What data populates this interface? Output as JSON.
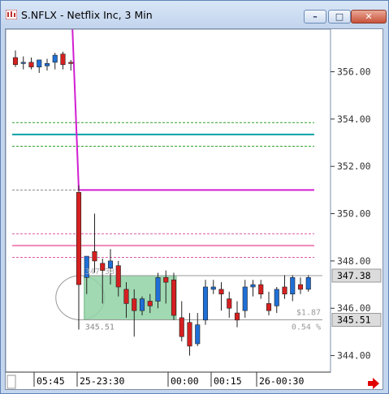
{
  "window": {
    "title": "S.NFLX - Netflix Inc, 3 Min",
    "buttons": {
      "minimize": "–",
      "maximize": "□",
      "close": "✕"
    }
  },
  "chart_data": {
    "type": "candlestick",
    "title": "S.NFLX - Netflix Inc, 3 Min",
    "ylim": [
      343.3,
      357.8
    ],
    "y_ticks": [
      {
        "value": 356,
        "label": "356.00"
      },
      {
        "value": 354,
        "label": "354.00"
      },
      {
        "value": 352,
        "label": "352.00"
      },
      {
        "value": 350,
        "label": "350.00"
      },
      {
        "value": 348,
        "label": "348.00"
      },
      {
        "value": 346,
        "label": "346.00"
      },
      {
        "value": 344,
        "label": "344.00"
      }
    ],
    "x_ticks": [
      "05:45",
      "25-23:30",
      "00:00",
      "00:15",
      "26-00:30"
    ],
    "price_tags": [
      {
        "value": 347.38,
        "label": "347.38"
      },
      {
        "value": 345.51,
        "label": "345.51"
      }
    ],
    "box_labels": {
      "high": "347.38",
      "low": "345.51",
      "range": "$1.87",
      "percent": "0.54 %"
    },
    "candles": [
      {
        "o": 356.6,
        "h": 356.9,
        "l": 356.2,
        "c": 356.3
      },
      {
        "o": 356.35,
        "h": 356.65,
        "l": 356.1,
        "c": 356.4
      },
      {
        "o": 356.4,
        "h": 356.6,
        "l": 356.1,
        "c": 356.2
      },
      {
        "o": 356.2,
        "h": 356.5,
        "l": 355.95,
        "c": 356.5
      },
      {
        "o": 356.25,
        "h": 356.55,
        "l": 356.05,
        "c": 356.35
      },
      {
        "o": 356.4,
        "h": 356.8,
        "l": 356.1,
        "c": 356.7
      },
      {
        "o": 356.75,
        "h": 356.85,
        "l": 356.1,
        "c": 356.3
      },
      {
        "o": 356.4,
        "h": 356.5,
        "l": 356.05,
        "c": 356.35
      },
      {
        "o": 350.9,
        "h": 351.2,
        "l": 345.1,
        "c": 347.0
      },
      {
        "o": 347.3,
        "h": 348.1,
        "l": 346.6,
        "c": 348.2
      },
      {
        "o": 348.4,
        "h": 350.0,
        "l": 347.5,
        "c": 348.0
      },
      {
        "o": 347.9,
        "h": 348.1,
        "l": 346.2,
        "c": 347.6
      },
      {
        "o": 347.7,
        "h": 348.5,
        "l": 347.0,
        "c": 348.0
      },
      {
        "o": 347.8,
        "h": 348.0,
        "l": 346.5,
        "c": 346.9
      },
      {
        "o": 346.8,
        "h": 347.1,
        "l": 345.6,
        "c": 346.2
      },
      {
        "o": 346.4,
        "h": 346.8,
        "l": 344.8,
        "c": 345.9
      },
      {
        "o": 345.9,
        "h": 346.5,
        "l": 345.7,
        "c": 346.4
      },
      {
        "o": 346.3,
        "h": 346.6,
        "l": 345.8,
        "c": 346.1
      },
      {
        "o": 346.3,
        "h": 347.5,
        "l": 346.0,
        "c": 347.3
      },
      {
        "o": 347.3,
        "h": 347.6,
        "l": 346.2,
        "c": 347.1
      },
      {
        "o": 347.2,
        "h": 347.5,
        "l": 345.5,
        "c": 345.7
      },
      {
        "o": 345.6,
        "h": 346.3,
        "l": 344.6,
        "c": 344.8
      },
      {
        "o": 345.4,
        "h": 345.8,
        "l": 344.0,
        "c": 344.4
      },
      {
        "o": 344.5,
        "h": 345.8,
        "l": 344.4,
        "c": 345.3
      },
      {
        "o": 345.5,
        "h": 347.2,
        "l": 345.3,
        "c": 346.9
      },
      {
        "o": 346.8,
        "h": 347.2,
        "l": 346.6,
        "c": 346.9
      },
      {
        "o": 346.8,
        "h": 347.1,
        "l": 345.9,
        "c": 346.6
      },
      {
        "o": 346.4,
        "h": 346.7,
        "l": 345.6,
        "c": 346.0
      },
      {
        "o": 345.8,
        "h": 346.3,
        "l": 345.2,
        "c": 345.5
      },
      {
        "o": 345.9,
        "h": 347.2,
        "l": 345.6,
        "c": 346.9
      },
      {
        "o": 346.9,
        "h": 347.2,
        "l": 346.5,
        "c": 347.0
      },
      {
        "o": 347.0,
        "h": 347.2,
        "l": 346.4,
        "c": 346.6
      },
      {
        "o": 346.2,
        "h": 346.7,
        "l": 345.7,
        "c": 345.9
      },
      {
        "o": 346.1,
        "h": 346.9,
        "l": 345.8,
        "c": 346.8
      },
      {
        "o": 346.9,
        "h": 347.4,
        "l": 346.4,
        "c": 346.6
      },
      {
        "o": 346.6,
        "h": 347.4,
        "l": 346.3,
        "c": 347.3
      },
      {
        "o": 347.0,
        "h": 347.3,
        "l": 346.6,
        "c": 346.8
      },
      {
        "o": 346.8,
        "h": 347.4,
        "l": 346.7,
        "c": 347.3
      }
    ],
    "horizontal_levels": [
      {
        "value": 353.85,
        "color": "#2ca02c",
        "style": "dashed"
      },
      {
        "value": 353.35,
        "color": "#0aa1a8",
        "style": "solid"
      },
      {
        "value": 352.85,
        "color": "#2ca02c",
        "style": "dashed"
      },
      {
        "value": 351.0,
        "color": "#888888",
        "style": "dashed"
      },
      {
        "value": 351.0,
        "color": "#d11fd1",
        "style": "solid",
        "from_bar": 8
      },
      {
        "value": 349.15,
        "color": "#e05aa8",
        "style": "dashed"
      },
      {
        "value": 348.65,
        "color": "#f088b8",
        "style": "solid"
      },
      {
        "value": 348.15,
        "color": "#e05aa8",
        "style": "dashed"
      }
    ],
    "drop_line": {
      "from": 358.0,
      "to": 351.0,
      "color": "#d11fd1"
    },
    "range_box": {
      "from_bar": 9,
      "to_bar": 20,
      "high": 347.38,
      "low": 345.51,
      "color": "#8fd2a4"
    },
    "colors": {
      "up": "#1f6fd6",
      "down": "#d62020",
      "accent": "#d11fd1",
      "navy": "#1a1a6a"
    }
  }
}
